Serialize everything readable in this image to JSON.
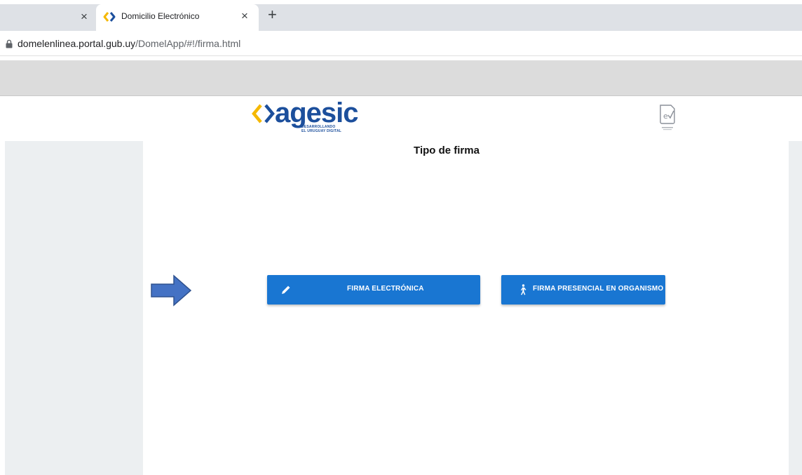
{
  "browser": {
    "tabs": [
      {
        "title": "Domicilio Electrónico",
        "active": true
      }
    ],
    "close_glyph": "×",
    "new_tab_glyph": "+",
    "url_host": "domelenlinea.portal.gub.uy",
    "url_path": "/DomelApp/#!/firma.html"
  },
  "header": {
    "logo_word": "agesic",
    "logo_tagline_1": "DESARROLLANDO",
    "logo_tagline_2": "EL URUGUAY DIGITAL",
    "logo_colors": {
      "yellow": "#f5b800",
      "blue": "#1c4f9c"
    }
  },
  "main": {
    "title": "Tipo de firma",
    "buttons": [
      {
        "label": "FIRMA ELECTRÓNICA",
        "icon": "pencil-icon"
      },
      {
        "label": "FIRMA PRESENCIAL EN ORGANISMO",
        "icon": "walking-person-icon"
      }
    ]
  },
  "colors": {
    "button_blue": "#1976d2",
    "arrow_blue": "#4472c4",
    "side_panel": "#eceff1"
  }
}
